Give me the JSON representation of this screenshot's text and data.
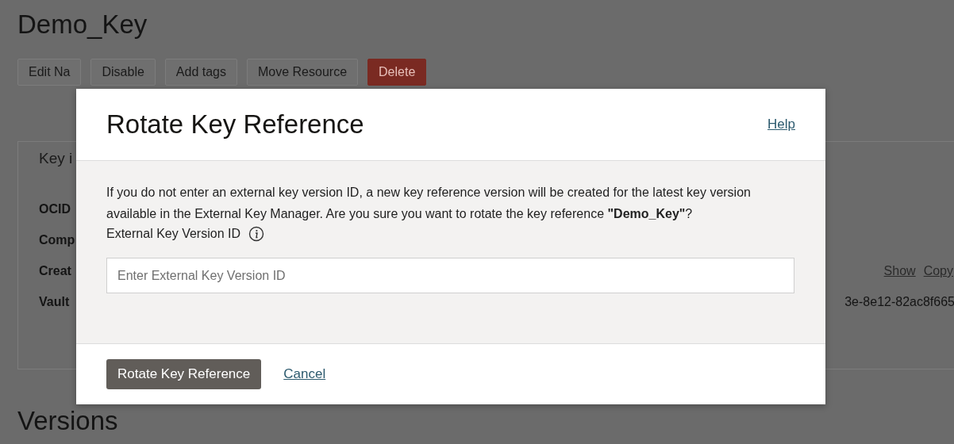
{
  "page": {
    "title": "Demo_Key",
    "actions": [
      {
        "label": "Edit Na",
        "kind": "default"
      },
      {
        "label": "Disable",
        "kind": "default"
      },
      {
        "label": "Add tags",
        "kind": "default"
      },
      {
        "label": "Move Resource",
        "kind": "default"
      },
      {
        "label": "Delete",
        "kind": "danger"
      }
    ],
    "panel": {
      "tab": "Key i",
      "rows": [
        {
          "label": "OCID",
          "links": [],
          "value": ""
        },
        {
          "label": "Comp",
          "links": [],
          "value": ""
        },
        {
          "label": "Creat",
          "links": [
            "Show",
            "Copy"
          ],
          "value": ""
        },
        {
          "label": "Vault",
          "links": [],
          "value": "3e-8e12-82ac8f665"
        }
      ]
    },
    "section_title": "Versions"
  },
  "dialog": {
    "title": "Rotate Key Reference",
    "help": "Help",
    "message": "If you do not enter an external key version ID, a new key reference version will be created for the latest key version available in the External Key Manager. Are you sure you want to rotate the key reference **\"Demo_Key\"**?",
    "field": {
      "label": "External Key Version ID",
      "placeholder": "Enter External Key Version ID"
    },
    "primary_button": "Rotate Key Reference",
    "cancel": "Cancel"
  }
}
